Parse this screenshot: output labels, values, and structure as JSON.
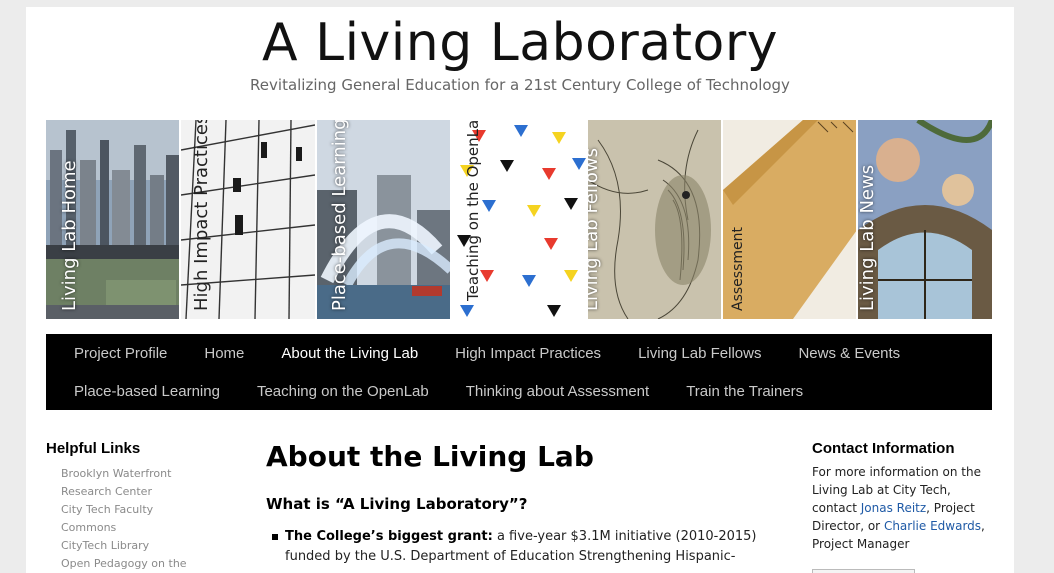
{
  "header": {
    "site_title": "A Living Laboratory",
    "tagline": "Revitalizing General Education for a 21st Century College of Technology"
  },
  "tiles": [
    {
      "label": "Living Lab Home",
      "icon": "cityscape-photo"
    },
    {
      "label": "High Impact Practices",
      "icon": "ironworkers-photo"
    },
    {
      "label": "Place-based Learning",
      "icon": "fireboat-photo"
    },
    {
      "label": "Teaching on the OpenLab",
      "icon": "triangles-pattern"
    },
    {
      "label": "Living Lab Fellows",
      "icon": "owl-engraving"
    },
    {
      "label": "Assessment",
      "icon": "ruler-photo"
    },
    {
      "label": "Living Lab News",
      "icon": "fresco-photo"
    }
  ],
  "nav": {
    "row1": [
      "Project Profile",
      "Home",
      "About the Living Lab",
      "High Impact Practices",
      "Living Lab Fellows",
      "News & Events"
    ],
    "row2": [
      "Place-based Learning",
      "Teaching on the OpenLab",
      "Thinking about Assessment",
      "Train the Trainers"
    ],
    "active": "About the Living Lab"
  },
  "helpful_links": {
    "title": "Helpful Links",
    "items": [
      "Brooklyn Waterfront",
      "Research Center",
      "City Tech Faculty",
      "Commons",
      "CityTech Library",
      "Open Pedagogy on the"
    ]
  },
  "main": {
    "page_title": "About the Living Lab",
    "question": "What is “A Living Laboratory”?",
    "bullet_strong": "The College’s biggest grant:",
    "bullet_text": " a five-year $3.1M initiative (2010-2015) funded by the U.S. Department of Education Strengthening Hispanic-"
  },
  "contact": {
    "title": "Contact Information",
    "text1": "For more information on the Living Lab at City Tech, contact ",
    "link1": "Jonas Reitz",
    "text2": ", Project Director, or ",
    "link2": "Charlie Edwards",
    "text3": ", Project Manager"
  },
  "colors": {
    "nav_bg": "#000000",
    "nav_text": "#c9c9c9",
    "link": "#1f5aa6",
    "page_bg": "#ececec"
  }
}
